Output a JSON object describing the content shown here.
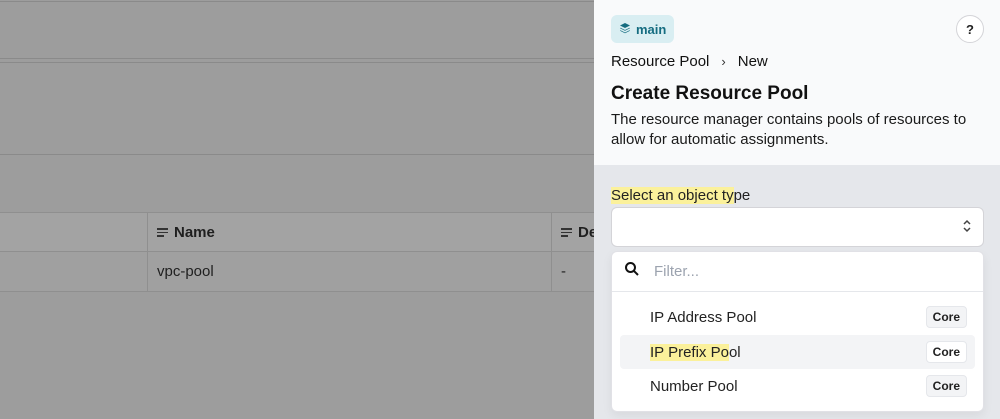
{
  "background_table": {
    "columns": [
      "Name",
      "De"
    ],
    "rows": [
      [
        "vpc-pool",
        "-"
      ]
    ]
  },
  "panel": {
    "branch": "main",
    "help": "?",
    "breadcrumb": [
      "Resource Pool",
      "New"
    ],
    "title": "Create Resource Pool",
    "description": "The resource manager contains pools of resources to allow for automatic assignments.",
    "field_label_hl": "Select an object ty",
    "field_label_rest": "pe",
    "filter_placeholder": "Filter...",
    "options": [
      {
        "label_hl": "",
        "label_rest": "IP Address Pool",
        "badge": "Core"
      },
      {
        "label_hl": "IP Prefix Po",
        "label_rest": "ol",
        "badge": "Core"
      },
      {
        "label_hl": "",
        "label_rest": "Number Pool",
        "badge": "Core"
      }
    ],
    "colors": {
      "branch_bg": "#d9eef2",
      "branch_fg": "#146c80",
      "highlight": "#fbf19b"
    },
    "icons": {
      "branch": "layers-icon",
      "search": "search-icon",
      "select": "chevron-up-down-icon"
    }
  }
}
